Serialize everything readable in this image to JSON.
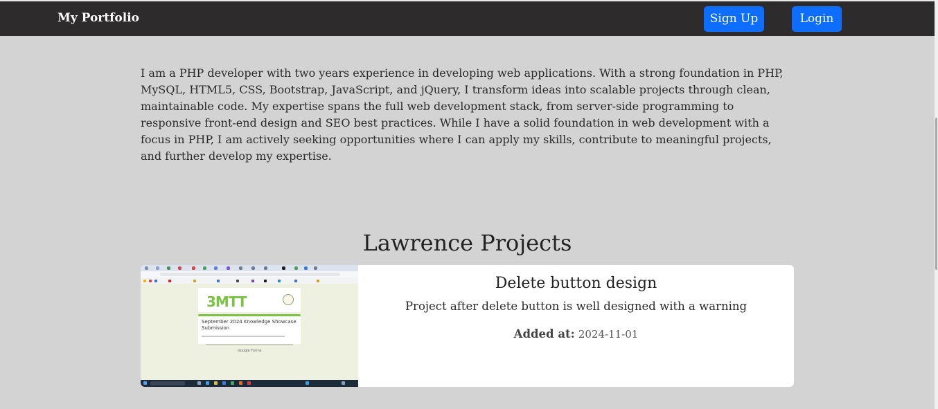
{
  "navbar": {
    "brand": "My Portfolio",
    "signup_label": "Sign Up",
    "login_label": "Login"
  },
  "about": {
    "text": "I am a PHP developer with two years experience in developing web applications. With a strong foundation in PHP, MySQL, HTML5, CSS, Bootstrap, JavaScript, and jQuery, I transform ideas into scalable projects through clean, maintainable code. My expertise spans the full web development stack, from server-side programming to responsive front-end design and SEO best practices. While I have a solid foundation in web development with a focus in PHP, I am actively seeking opportunities where I can apply my skills, contribute to meaningful projects, and further develop my expertise."
  },
  "projects": {
    "heading": "Lawrence Projects",
    "items": [
      {
        "title": "Delete button design",
        "description": "Project after delete button is well designed with a warning",
        "added_label": "Added at:",
        "added_date": "2024-11-01",
        "thumbnail": {
          "logo_text": "3MTT",
          "form_title": "September 2024 Knowledge Showcase Submission",
          "footer_text": "Google Forms"
        }
      }
    ]
  },
  "colors": {
    "navbar_bg": "#2d2b2b",
    "page_bg": "#d3d3d3",
    "button_blue": "#0d6efd",
    "card_bg": "#ffffff",
    "logo_green": "#7cc242"
  }
}
